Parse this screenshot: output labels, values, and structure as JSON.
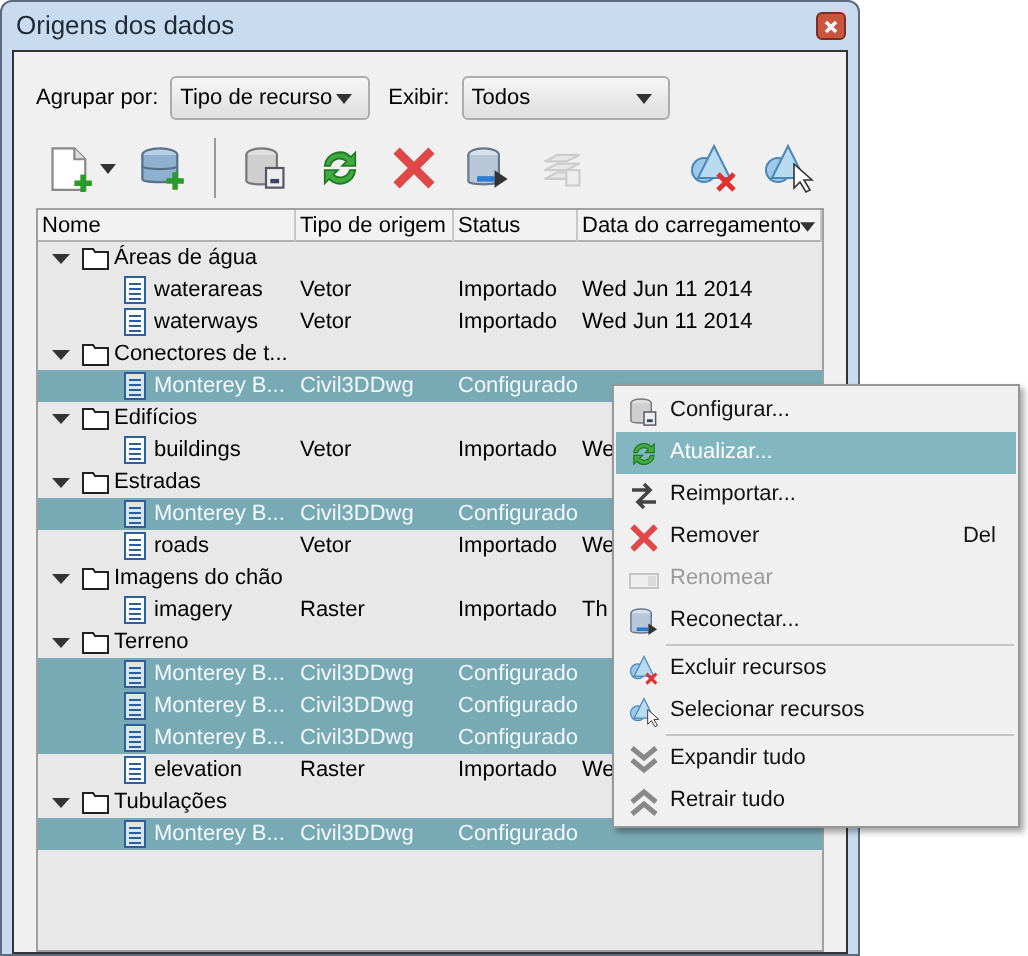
{
  "window": {
    "title": "Origens dos dados"
  },
  "filters": [
    {
      "label": "Agrupar por:",
      "value": "Tipo de recurso"
    },
    {
      "label": "Exibir:",
      "value": "Todos"
    }
  ],
  "toolbar": [
    {
      "kind": "new",
      "disabled": false
    },
    {
      "kind": "db-add",
      "disabled": false
    },
    {
      "kind": "db-config",
      "disabled": false
    },
    {
      "kind": "refresh",
      "disabled": false
    },
    {
      "kind": "remove",
      "disabled": false
    },
    {
      "kind": "reconnect",
      "disabled": false
    },
    {
      "kind": "layers",
      "disabled": true
    },
    {
      "kind": "exclude",
      "disabled": false
    },
    {
      "kind": "select",
      "disabled": false
    }
  ],
  "table": {
    "columns": [
      "Nome",
      "Tipo de origem",
      "Status",
      "Data do carregamento"
    ],
    "groups": [
      {
        "name": "Áreas de água",
        "expanded": true,
        "children": [
          {
            "name": "waterareas",
            "source_type": "Vetor",
            "status": "Importado",
            "loaded": "Wed Jun 11 2014",
            "selected": false
          },
          {
            "name": "waterways",
            "source_type": "Vetor",
            "status": "Importado",
            "loaded": "Wed Jun 11 2014",
            "selected": false
          }
        ]
      },
      {
        "name": "Conectores de t...",
        "expanded": true,
        "children": [
          {
            "name": "Monterey B...",
            "source_type": "Civil3DDwg",
            "status": "Configurado",
            "selected": true
          }
        ]
      },
      {
        "name": "Edifícios",
        "expanded": true,
        "children": [
          {
            "name": "buildings",
            "source_type": "Vetor",
            "status": "Importado",
            "loaded": "We",
            "selected": false
          }
        ]
      },
      {
        "name": "Estradas",
        "expanded": true,
        "children": [
          {
            "name": "Monterey B...",
            "source_type": "Civil3DDwg",
            "status": "Configurado",
            "selected": true
          },
          {
            "name": "roads",
            "source_type": "Vetor",
            "status": "Importado",
            "loaded": "We",
            "selected": false
          }
        ]
      },
      {
        "name": "Imagens do chão",
        "expanded": true,
        "children": [
          {
            "name": "imagery",
            "source_type": "Raster",
            "status": "Importado",
            "loaded": "Th",
            "selected": false
          }
        ]
      },
      {
        "name": "Terreno",
        "expanded": true,
        "children": [
          {
            "name": "Monterey B...",
            "source_type": "Civil3DDwg",
            "status": "Configurado",
            "selected": true
          },
          {
            "name": "Monterey B...",
            "source_type": "Civil3DDwg",
            "status": "Configurado",
            "selected": true
          },
          {
            "name": "Monterey B...",
            "source_type": "Civil3DDwg",
            "status": "Configurado",
            "selected": true
          },
          {
            "name": "elevation",
            "source_type": "Raster",
            "status": "Importado",
            "loaded": "We",
            "selected": false
          }
        ]
      },
      {
        "name": "Tubulações",
        "expanded": true,
        "children": [
          {
            "name": "Monterey B...",
            "source_type": "Civil3DDwg",
            "status": "Configurado",
            "selected": true
          }
        ]
      }
    ]
  },
  "context_menu": {
    "sections": [
      [
        {
          "label": "Configurar...",
          "kind": "db-config",
          "disabled": false,
          "selected": false
        },
        {
          "label": "Atualizar...",
          "kind": "refresh",
          "disabled": false,
          "selected": true
        },
        {
          "label": "Reimportar...",
          "kind": "arrows",
          "disabled": false,
          "selected": false
        },
        {
          "label": "Remover",
          "kind": "remove",
          "shortcut": "Del",
          "disabled": false,
          "selected": false
        },
        {
          "label": "Renomear",
          "kind": "rename",
          "disabled": true,
          "selected": false
        },
        {
          "label": "Reconectar...",
          "kind": "reconnect",
          "disabled": false,
          "selected": false
        }
      ],
      [
        {
          "label": "Excluir recursos",
          "kind": "exclude",
          "disabled": false,
          "selected": false
        },
        {
          "label": "Selecionar recursos",
          "kind": "select",
          "disabled": false,
          "selected": false
        }
      ],
      [
        {
          "label": "Expandir tudo",
          "kind": "expand",
          "disabled": false,
          "selected": false
        },
        {
          "label": "Retrair tudo",
          "kind": "collapse",
          "disabled": false,
          "selected": false
        }
      ]
    ]
  }
}
